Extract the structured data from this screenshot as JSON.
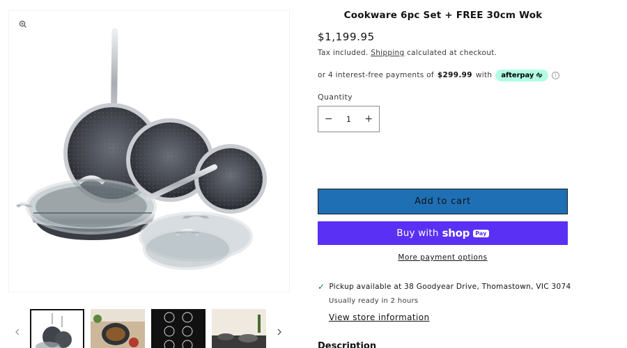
{
  "product": {
    "title": "Cookware 6pc Set + FREE 30cm Wok",
    "price": "$1,199.95",
    "tax_prefix": "Tax included.",
    "tax_link": "Shipping",
    "tax_suffix": "calculated at checkout."
  },
  "afterpay": {
    "prefix": "or 4 interest-free payments of",
    "amount": "$299.99",
    "with": "with",
    "badge": "afterpay",
    "info_icon": "info-icon"
  },
  "quantity": {
    "label": "Quantity",
    "value": "1",
    "minus": "−",
    "plus": "+"
  },
  "buttons": {
    "add_to_cart": "Add to cart",
    "buy_with": "Buy with",
    "shop": "shop",
    "pay": "Pay",
    "more_options": "More payment options"
  },
  "pickup": {
    "text": "Pickup available at 38 Goodyear Drive, Thomastown, VIC 3074",
    "ready": "Usually ready in 2 hours",
    "store_link": "View store information"
  },
  "description_heading": "Description",
  "colors": {
    "add_to_cart_bg": "#1f6fb5",
    "shop_pay_bg": "#5a31f4",
    "afterpay_bg": "#b2fce4",
    "check": "#108043"
  },
  "icons": {
    "zoom": "zoom-in-icon",
    "prev": "chevron-left-icon",
    "next": "chevron-right-icon",
    "check": "checkmark-icon"
  }
}
